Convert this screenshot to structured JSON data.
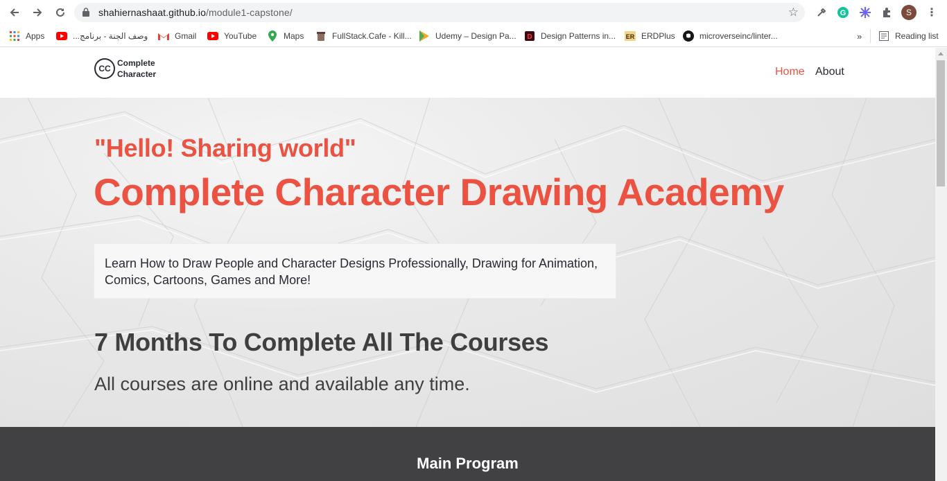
{
  "browser": {
    "url_host": "shahiernashaat.github.io",
    "url_path": "/module1-capstone/",
    "profile_initial": "S",
    "bookmarks": [
      {
        "label": "Apps",
        "icon": "apps-grid-icon"
      },
      {
        "label": "وصف الجنة - برنامج...",
        "icon": "youtube-icon"
      },
      {
        "label": "Gmail",
        "icon": "gmail-icon"
      },
      {
        "label": "YouTube",
        "icon": "youtube-icon"
      },
      {
        "label": "Maps",
        "icon": "maps-icon"
      },
      {
        "label": "FullStack.Cafe - Kill...",
        "icon": "cup-icon"
      },
      {
        "label": "Udemy – Design Pa...",
        "icon": "udemy-icon"
      },
      {
        "label": "Design Patterns in...",
        "icon": "d-icon"
      },
      {
        "label": "ERDPlus",
        "icon": "er-icon"
      },
      {
        "label": "microverseinc/linter...",
        "icon": "github-icon"
      }
    ],
    "more_bookmarks": "»",
    "reading_list": "Reading list"
  },
  "site": {
    "logo_mark": "CC",
    "logo_line1": "Complete",
    "logo_line2": "Character",
    "nav": [
      {
        "label": "Home",
        "active": true
      },
      {
        "label": "About",
        "active": false
      }
    ],
    "hero": {
      "greeting": "\"Hello! Sharing world\"",
      "title": "Complete Character Drawing Academy",
      "description": "Learn How to Draw People and Character Designs Professionally, Drawing for Animation, Comics, Cartoons, Games and More!",
      "heading": "7 Months To Complete All The Courses",
      "subtext": "All courses are online and available any time."
    },
    "program_title": "Main Program"
  },
  "colors": {
    "accent": "#ec5242",
    "dark": "#272a31",
    "program_bg": "#414042"
  }
}
